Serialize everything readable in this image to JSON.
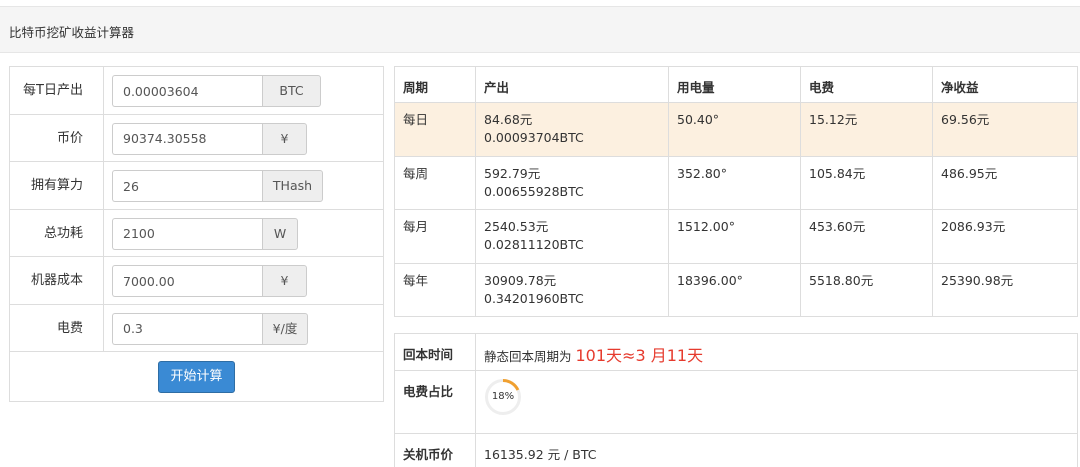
{
  "header": {
    "title": "比特币挖矿收益计算器"
  },
  "form": {
    "rows": [
      {
        "label": "每T日产出",
        "value": "0.00003604",
        "unit": "BTC"
      },
      {
        "label": "币价",
        "value": "90374.30558",
        "unit": "¥"
      },
      {
        "label": "拥有算力",
        "value": "26",
        "unit": "THash"
      },
      {
        "label": "总功耗",
        "value": "2100",
        "unit": "W"
      },
      {
        "label": "机器成本",
        "value": "7000.00",
        "unit": "¥"
      },
      {
        "label": "电费",
        "value": "0.3",
        "unit": "¥/度"
      }
    ],
    "start_label": "开始计算",
    "button_color": "#3a8ad4"
  },
  "results": {
    "headers": [
      "周期",
      "产出",
      "用电量",
      "电费",
      "净收益"
    ],
    "rows": [
      {
        "period": "每日",
        "out_cny": "84.68元",
        "out_btc": "0.00093704BTC",
        "power": "50.40°",
        "fee": "15.12元",
        "net": "69.56元",
        "highlight": true
      },
      {
        "period": "每周",
        "out_cny": "592.79元",
        "out_btc": "0.00655928BTC",
        "power": "352.80°",
        "fee": "105.84元",
        "net": "486.95元"
      },
      {
        "period": "每月",
        "out_cny": "2540.53元",
        "out_btc": "0.02811120BTC",
        "power": "1512.00°",
        "fee": "453.60元",
        "net": "2086.93元"
      },
      {
        "period": "每年",
        "out_cny": "30909.78元",
        "out_btc": "0.34201960BTC",
        "power": "18396.00°",
        "fee": "5518.80元",
        "net": "25390.98元"
      }
    ],
    "highlight_color": "#fcf0e0"
  },
  "summary": {
    "payback_label": "回本时间",
    "payback_prefix": "静态回本周期为",
    "payback_value": "101天≈3 月11天",
    "fee_ratio_label": "电费占比",
    "fee_ratio_text": "18%",
    "fee_ratio_value": 0.18,
    "fee_ratio_color": "#f0a030",
    "shutdown_label": "关机币价",
    "shutdown_value": "16135.92 元 / BTC"
  }
}
